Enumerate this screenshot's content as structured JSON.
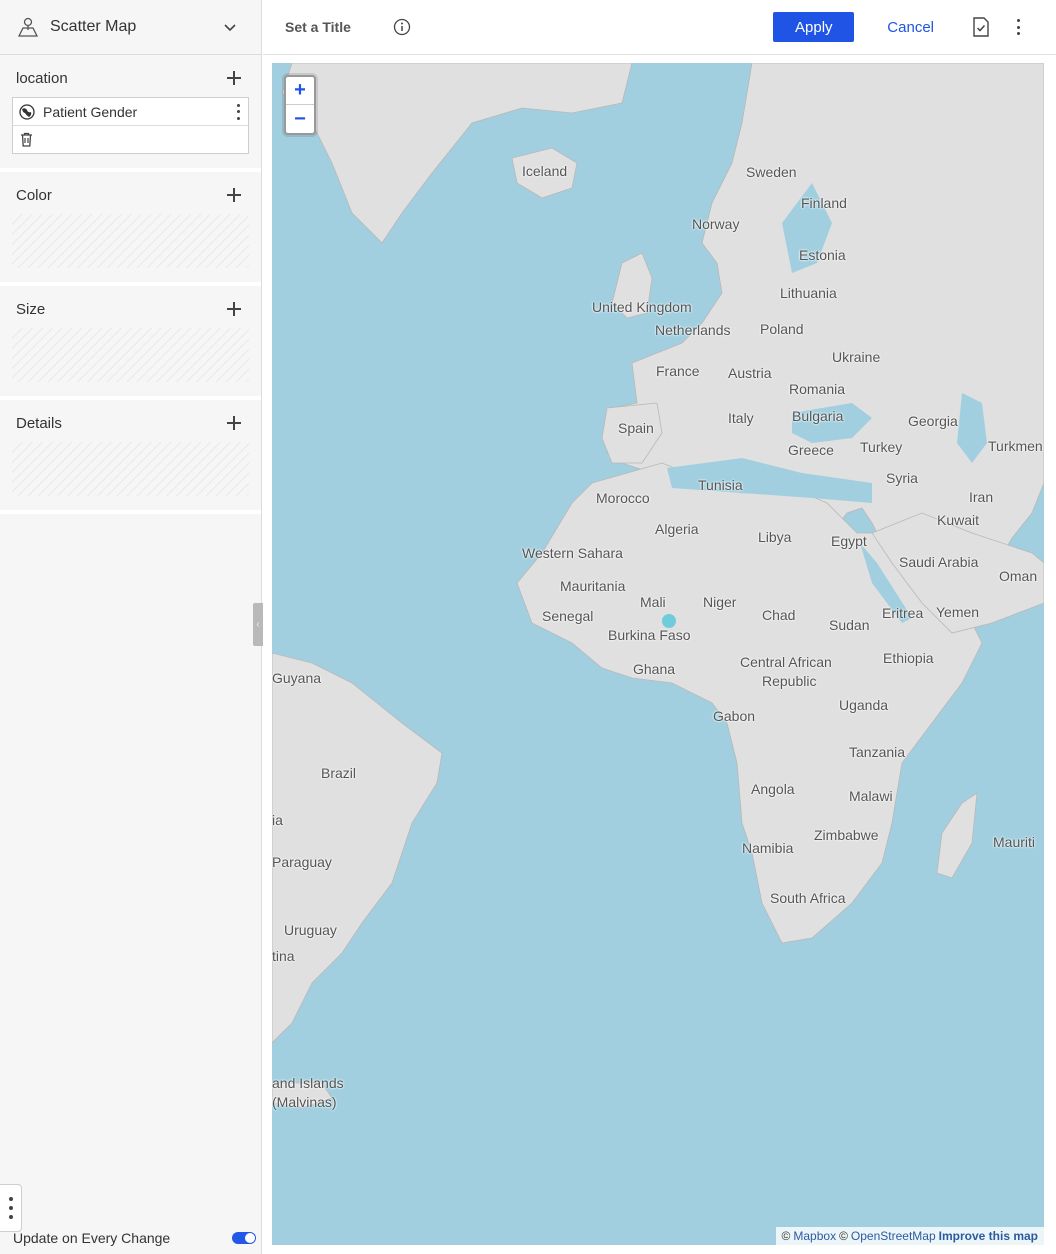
{
  "sidebar": {
    "viz_type": "Scatter Map",
    "viz_icon": "map-pin-icon",
    "panels": {
      "location": {
        "title": "location",
        "field": "Patient Gender"
      },
      "color": {
        "title": "Color"
      },
      "size": {
        "title": "Size"
      },
      "details": {
        "title": "Details"
      }
    },
    "update_label": "Update on Every Change",
    "update_on_change": true
  },
  "header": {
    "title": "Set a Title",
    "apply_label": "Apply",
    "cancel_label": "Cancel"
  },
  "map": {
    "labels": {
      "iceland": "Iceland",
      "sweden": "Sweden",
      "finland": "Finland",
      "norway": "Norway",
      "estonia": "Estonia",
      "united_kingdom": "United Kingdom",
      "lithuania": "Lithuania",
      "netherlands": "Netherlands",
      "poland": "Poland",
      "ukraine": "Ukraine",
      "france": "France",
      "austria": "Austria",
      "romania": "Romania",
      "italy": "Italy",
      "bulgaria": "Bulgaria",
      "georgia": "Georgia",
      "spain": "Spain",
      "turkey": "Turkey",
      "greece": "Greece",
      "turkmen": "Turkmen",
      "syria": "Syria",
      "tunisia": "Tunisia",
      "morocco": "Morocco",
      "iran": "Iran",
      "algeria": "Algeria",
      "libya": "Libya",
      "egypt": "Egypt",
      "kuwait": "Kuwait",
      "western_sahara": "Western Sahara",
      "saudi_arabia": "Saudi Arabia",
      "oman": "Oman",
      "mauritania": "Mauritania",
      "mali": "Mali",
      "niger": "Niger",
      "eritrea": "Eritrea",
      "yemen": "Yemen",
      "senegal": "Senegal",
      "chad": "Chad",
      "sudan": "Sudan",
      "burkina_faso": "Burkina Faso",
      "ethiopia": "Ethiopia",
      "ghana": "Ghana",
      "central_african": "Central African",
      "republic": "Republic",
      "guyana": "Guyana",
      "uganda": "Uganda",
      "gabon": "Gabon",
      "tanzania": "Tanzania",
      "brazil": "Brazil",
      "angola": "Angola",
      "malawi": "Malawi",
      "bolivia_fragment": "ia",
      "mauritius": "Mauriti",
      "zimbabwe": "Zimbabwe",
      "namibia": "Namibia",
      "paraguay": "Paraguay",
      "south_africa": "South Africa",
      "uruguay": "Uruguay",
      "argentina_fragment": "tina",
      "falkland_1": "and Islands",
      "falkland_2": "(Malvinas)"
    },
    "zoom_in": "+",
    "zoom_out": "−",
    "attribution": {
      "copyright_1": "©",
      "mapbox": "Mapbox",
      "copyright_2": "©",
      "osm": "OpenStreetMap",
      "improve": "Improve this map"
    },
    "point_color": "#5bc9d8"
  },
  "colors": {
    "accent": "#1f54e5",
    "water": "#a2cfdf",
    "land": "#e0e0e0"
  }
}
